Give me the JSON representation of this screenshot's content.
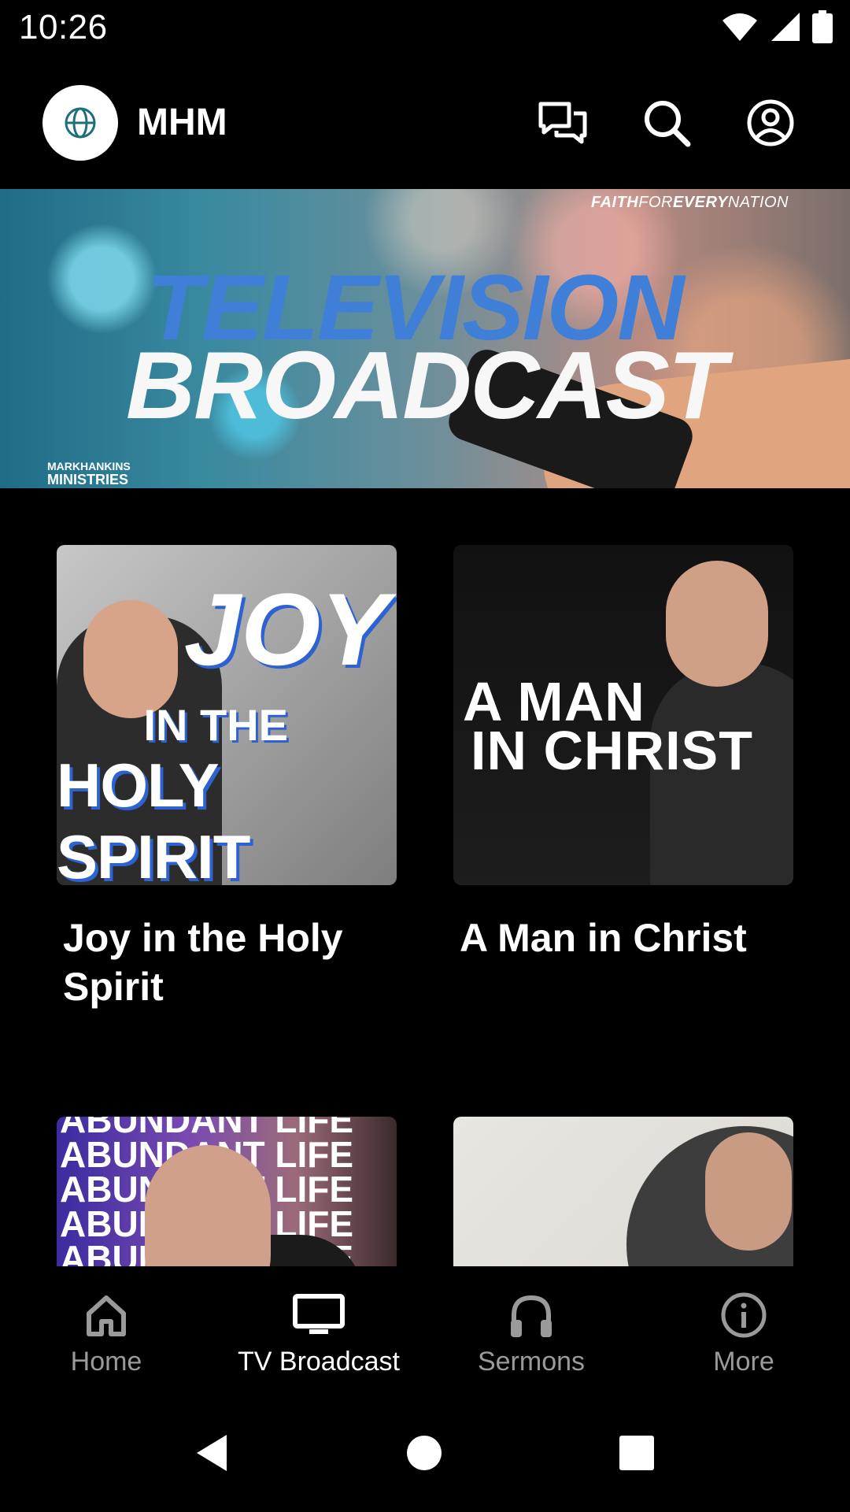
{
  "status_bar": {
    "time": "10:26"
  },
  "app_bar": {
    "title": "MHM",
    "icons": [
      "chat-icon",
      "search-icon",
      "account-icon"
    ]
  },
  "banner": {
    "tagline_a": "FAITH",
    "tagline_b": "FOR",
    "tagline_c": "EVERY",
    "tagline_d": "NATION",
    "line1": "TELEVISION",
    "line2": "BROADCAST",
    "brand_top": "MARKHANKINS",
    "brand_bottom": "MINISTRIES"
  },
  "cards": [
    {
      "title": "Joy in the Holy Spirit",
      "art_1": "JOY",
      "art_2": "IN THE",
      "art_3": "HOLY SPIRIT"
    },
    {
      "title": "A Man in Christ",
      "art_1": "A MAN",
      "art_2": "IN CHRIST"
    },
    {
      "title": "",
      "art_1": "ABUNDANT LIFE"
    },
    {
      "title": ""
    }
  ],
  "bottom_nav": {
    "items": [
      {
        "label": "Home",
        "icon": "home-icon",
        "active": false
      },
      {
        "label": "TV Broadcast",
        "icon": "tv-icon",
        "active": true
      },
      {
        "label": "Sermons",
        "icon": "headphones-icon",
        "active": false
      },
      {
        "label": "More",
        "icon": "info-icon",
        "active": false
      }
    ]
  },
  "colors": {
    "accent_blue": "#3f7fd8",
    "inactive": "#9a9a9a",
    "background": "#000000"
  }
}
